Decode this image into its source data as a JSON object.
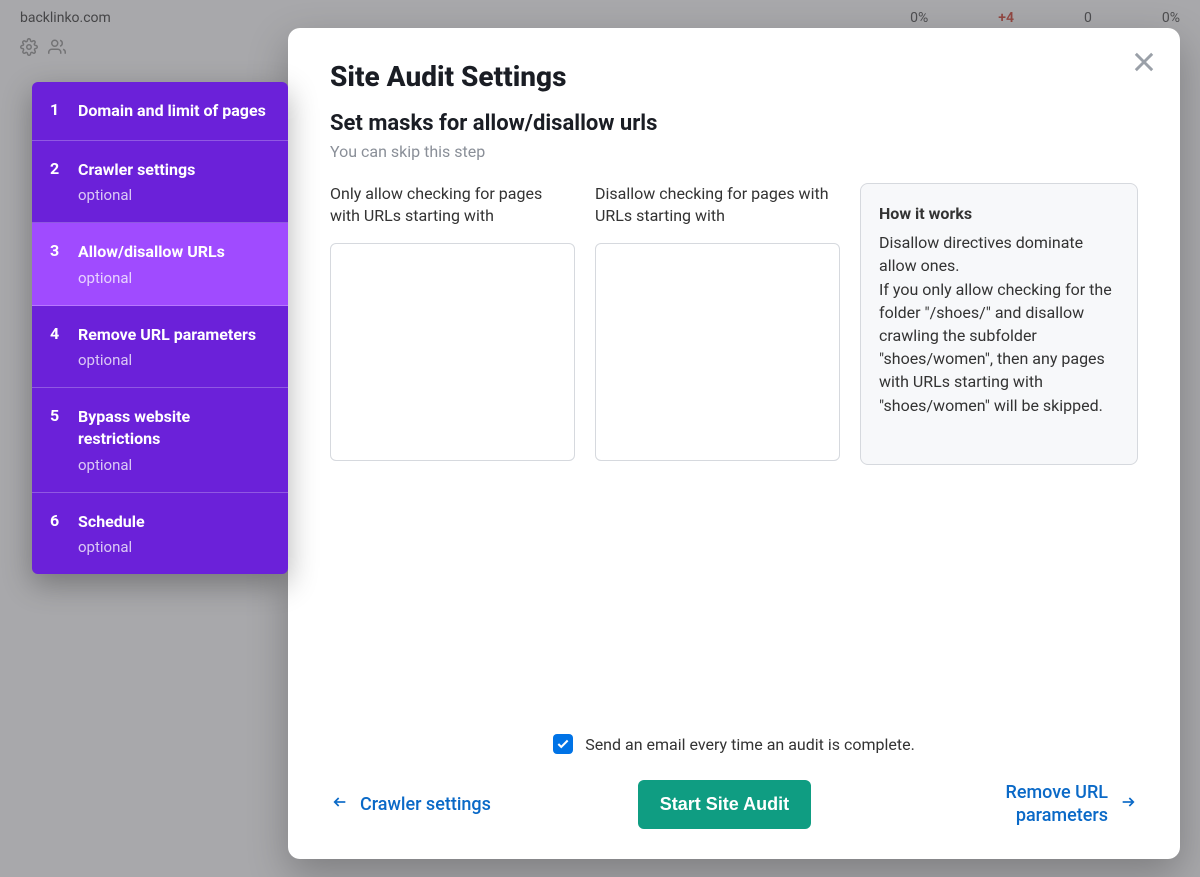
{
  "background": {
    "domain": "backlinko.com",
    "metrics": [
      "0%",
      "+4",
      "0",
      "0%"
    ]
  },
  "sidebar": {
    "steps": [
      {
        "num": "1",
        "title": "Domain and limit of pages",
        "sub": ""
      },
      {
        "num": "2",
        "title": "Crawler settings",
        "sub": "optional"
      },
      {
        "num": "3",
        "title": "Allow/disallow URLs",
        "sub": "optional"
      },
      {
        "num": "4",
        "title": "Remove URL parameters",
        "sub": "optional"
      },
      {
        "num": "5",
        "title": "Bypass website restrictions",
        "sub": "optional"
      },
      {
        "num": "6",
        "title": "Schedule",
        "sub": "optional"
      }
    ],
    "active_index": 2
  },
  "modal": {
    "title": "Site Audit Settings",
    "subtitle": "Set masks for allow/disallow urls",
    "help": "You can skip this step",
    "allow_label": "Only allow checking for pages with URLs starting with",
    "disallow_label": "Disallow checking for pages with URLs starting with",
    "info": {
      "title": "How it works",
      "body": "Disallow directives dominate allow ones.\nIf you only allow checking for the folder \"/shoes/\" and disallow crawling the subfolder \"shoes/women\", then any pages with URLs starting with \"shoes/women\" will be skipped."
    },
    "email_checkbox_checked": true,
    "email_label": "Send an email every time an audit is complete.",
    "back_label": "Crawler settings",
    "primary_label": "Start Site Audit",
    "next_label": "Remove URL parameters"
  }
}
